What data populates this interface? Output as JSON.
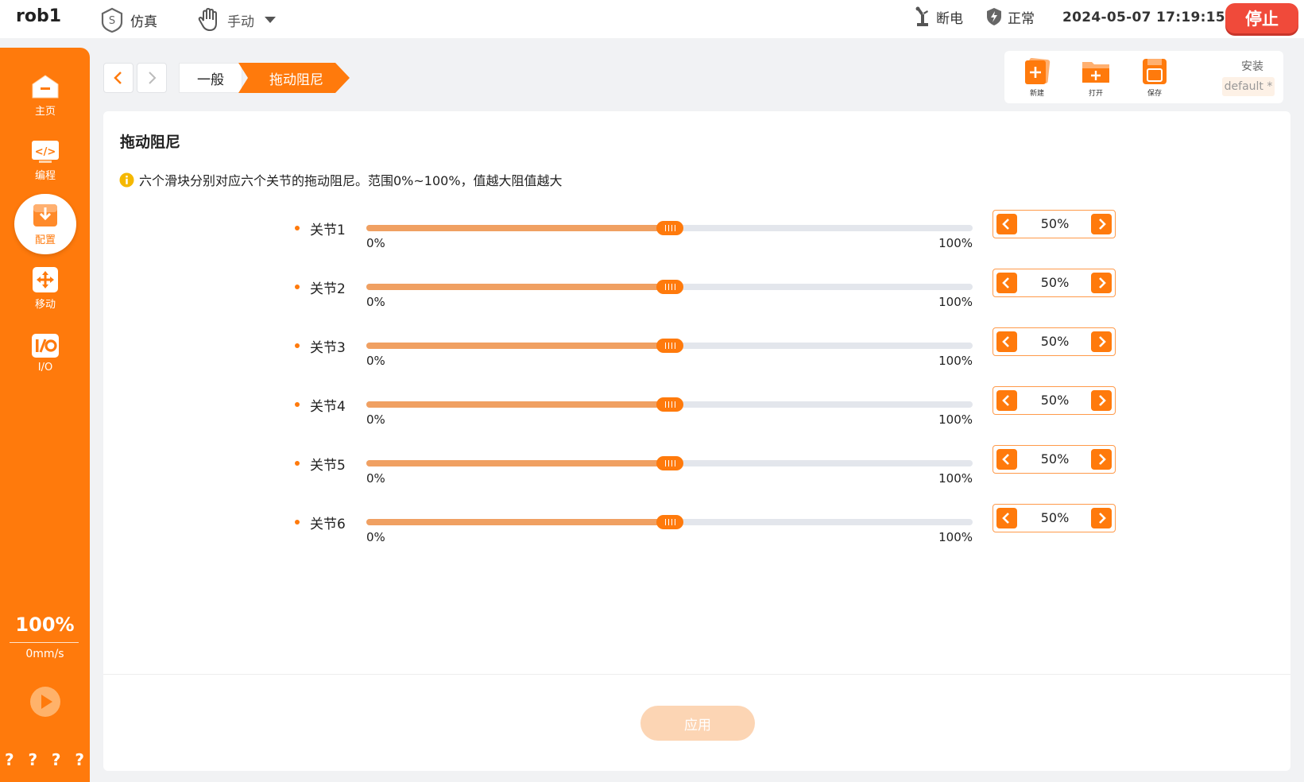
{
  "topbar": {
    "robot_name": "rob1",
    "sim_label": "仿真",
    "mode_label": "手动",
    "power_label": "断电",
    "status_label": "正常",
    "datetime": "2024-05-07 17:19:15",
    "stop_label": "停止"
  },
  "sidebar": {
    "items": [
      {
        "label": "主页",
        "icon": "home-icon"
      },
      {
        "label": "编程",
        "icon": "code-icon"
      },
      {
        "label": "配置",
        "icon": "config-download-icon"
      },
      {
        "label": "移动",
        "icon": "move-icon"
      },
      {
        "label": "I/O",
        "icon": "io-icon"
      }
    ],
    "active": "配置",
    "speed_percent": "100%",
    "speed_mms": "0mm/s",
    "help": [
      "?",
      "?",
      "?",
      "?"
    ]
  },
  "breadcrumb": {
    "general": "一般",
    "current": "拖动阻尼"
  },
  "file_toolbar": {
    "new_label": "新建",
    "open_label": "打开",
    "save_label": "保存",
    "install_label": "安装",
    "install_value": "default *"
  },
  "panel": {
    "title": "拖动阻尼",
    "info": "六个滑块分别对应六个关节的拖动阻尼。范围0%~100%，值越大阻值越大",
    "min_label": "0%",
    "max_label": "100%",
    "apply_label": "应用"
  },
  "joints": [
    {
      "label": "关节1",
      "value": 50,
      "display": "50%"
    },
    {
      "label": "关节2",
      "value": 50,
      "display": "50%"
    },
    {
      "label": "关节3",
      "value": 50,
      "display": "50%"
    },
    {
      "label": "关节4",
      "value": 50,
      "display": "50%"
    },
    {
      "label": "关节5",
      "value": 50,
      "display": "50%"
    },
    {
      "label": "关节6",
      "value": 50,
      "display": "50%"
    }
  ],
  "colors": {
    "accent": "#ff7a0c",
    "track": "#e3e6ec",
    "track_fill": "#f0a062",
    "stop": "#f04a3a",
    "apply_disabled": "#fcd5b4"
  }
}
